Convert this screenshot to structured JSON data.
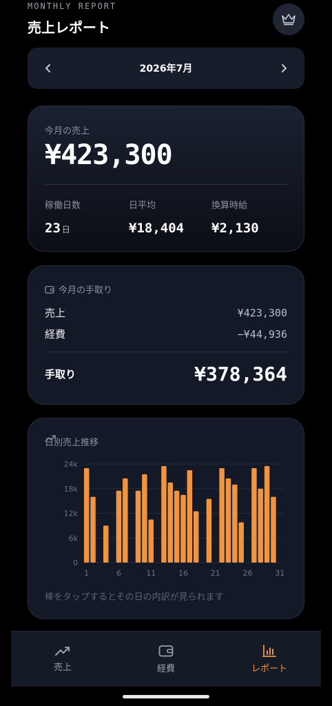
{
  "header": {
    "eyebrow": "MONTHLY REPORT",
    "title": "売上レポート",
    "premium_icon": "crown-icon"
  },
  "month_nav": {
    "label": "2026年7月",
    "prev_icon": "chevron-left-icon",
    "next_icon": "chevron-right-icon"
  },
  "summary": {
    "caption": "今月の売上",
    "total": "¥423,300",
    "stats": [
      {
        "label": "稼働日数",
        "value": "23",
        "unit": "日"
      },
      {
        "label": "日平均",
        "value": "¥18,404",
        "unit": ""
      },
      {
        "label": "換算時給",
        "value": "¥2,130",
        "unit": ""
      }
    ]
  },
  "net_income": {
    "heading": "今月の手取り",
    "rows": [
      {
        "label": "売上",
        "value": "¥423,300"
      },
      {
        "label": "経費",
        "value": "−¥44,936"
      }
    ],
    "total_label": "手取り",
    "total_value": "¥378,364"
  },
  "daily_chart": {
    "heading": "日別売上推移",
    "hint": "棒をタップするとその日の内訳が見られます"
  },
  "chart_data": {
    "type": "bar",
    "title": "日別売上推移",
    "x": [
      1,
      2,
      3,
      4,
      5,
      6,
      7,
      8,
      9,
      10,
      11,
      12,
      13,
      14,
      15,
      16,
      17,
      18,
      19,
      20,
      21,
      22,
      23,
      24,
      25,
      26,
      27,
      28,
      29,
      30,
      31
    ],
    "values": [
      23000,
      16000,
      0,
      9000,
      0,
      17500,
      20500,
      0,
      17500,
      21500,
      10500,
      0,
      23500,
      19500,
      17500,
      16500,
      22500,
      12500,
      0,
      15500,
      0,
      23000,
      20500,
      19000,
      9800,
      0,
      23000,
      18000,
      23500,
      16000,
      0
    ],
    "xtick_labels": [
      "1",
      "6",
      "11",
      "16",
      "21",
      "26",
      "31"
    ],
    "ytick_labels": [
      "0",
      "6k",
      "12k",
      "18k",
      "24k"
    ],
    "ylim": [
      0,
      24000
    ],
    "grid": true,
    "bar_color": "#f0943f"
  },
  "tabbar": {
    "tabs": [
      {
        "label": "売上",
        "icon": "trend-up-icon",
        "active": false
      },
      {
        "label": "経費",
        "icon": "wallet-icon",
        "active": false
      },
      {
        "label": "レポート",
        "icon": "bar-chart-icon",
        "active": true
      }
    ]
  },
  "colors": {
    "accent": "#f0943f",
    "card": "#131927",
    "background": "#000000"
  }
}
